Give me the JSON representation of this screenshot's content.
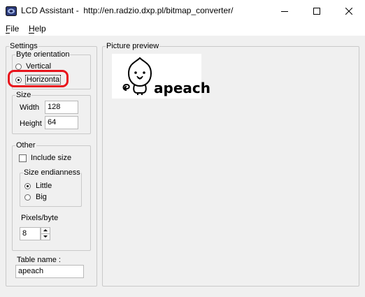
{
  "window": {
    "title": "LCD Assistant -  http://en.radzio.dxp.pl/bitmap_converter/"
  },
  "menu": {
    "file": "File",
    "help": "Help"
  },
  "settings": {
    "group_label": "Settings",
    "byte_orientation": {
      "label": "Byte orientation",
      "vertical": "Vertical",
      "horizontal": "Horizonta",
      "selected": "horizontal"
    },
    "size": {
      "label": "Size",
      "width_label": "Width",
      "width_value": "128",
      "height_label": "Height",
      "height_value": "64"
    },
    "other": {
      "label": "Other",
      "include_size": "Include size",
      "include_size_checked": false,
      "endianness": {
        "label": "Size endianness",
        "little": "Little",
        "big": "Big",
        "selected": "little"
      },
      "pixels_label": "Pixels/byte",
      "pixels_value": "8"
    },
    "table_name_label": "Table name :",
    "table_name_value": "apeach"
  },
  "preview": {
    "label": "Picture preview",
    "image_text": "apeach"
  },
  "highlight_color": "#e8141c"
}
